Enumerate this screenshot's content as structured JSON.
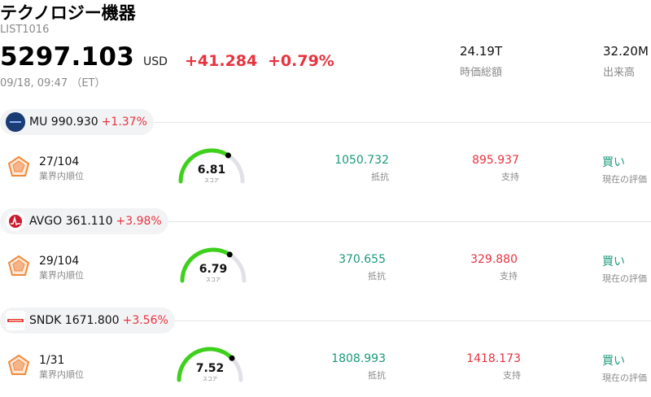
{
  "header": {
    "title": "テクノロジー機器",
    "list_id": "LIST1016",
    "price": "5297.103",
    "currency": "USD",
    "change": "+41.284",
    "change_pct": "+0.79%",
    "timestamp": "09/18, 09:47 （ET）",
    "market_cap_value": "24.19T",
    "market_cap_label": "時価総額",
    "volume_value": "32.20M",
    "volume_label": "出来高"
  },
  "colors": {
    "up": "#e8333f",
    "green": "#1a9a7a",
    "gauge": "#3dd11c"
  },
  "rows": [
    {
      "ticker": "MU",
      "price": "990.930",
      "change_pct": "+1.37%",
      "logo_icon": "micron-logo-icon",
      "rank": "27/104",
      "rank_label": "業界内順位",
      "score": "6.81",
      "score_label": "スコア",
      "score_frac": 0.681,
      "resistance": "1050.732",
      "resistance_label": "抵抗",
      "support": "895.937",
      "support_label": "支持",
      "rating": "買い",
      "rating_label": "現在の評価"
    },
    {
      "ticker": "AVGO",
      "price": "361.110",
      "change_pct": "+3.98%",
      "logo_icon": "broadcom-logo-icon",
      "rank": "29/104",
      "rank_label": "業界内順位",
      "score": "6.79",
      "score_label": "スコア",
      "score_frac": 0.679,
      "resistance": "370.655",
      "resistance_label": "抵抗",
      "support": "329.880",
      "support_label": "支持",
      "rating": "買い",
      "rating_label": "現在の評価"
    },
    {
      "ticker": "SNDK",
      "price": "1671.800",
      "change_pct": "+3.56%",
      "logo_icon": "sandisk-logo-icon",
      "rank": "1/31",
      "rank_label": "業界内順位",
      "score": "7.52",
      "score_label": "スコア",
      "score_frac": 0.752,
      "resistance": "1808.993",
      "resistance_label": "抵抗",
      "support": "1418.173",
      "support_label": "支持",
      "rating": "買い",
      "rating_label": "現在の評価"
    }
  ]
}
